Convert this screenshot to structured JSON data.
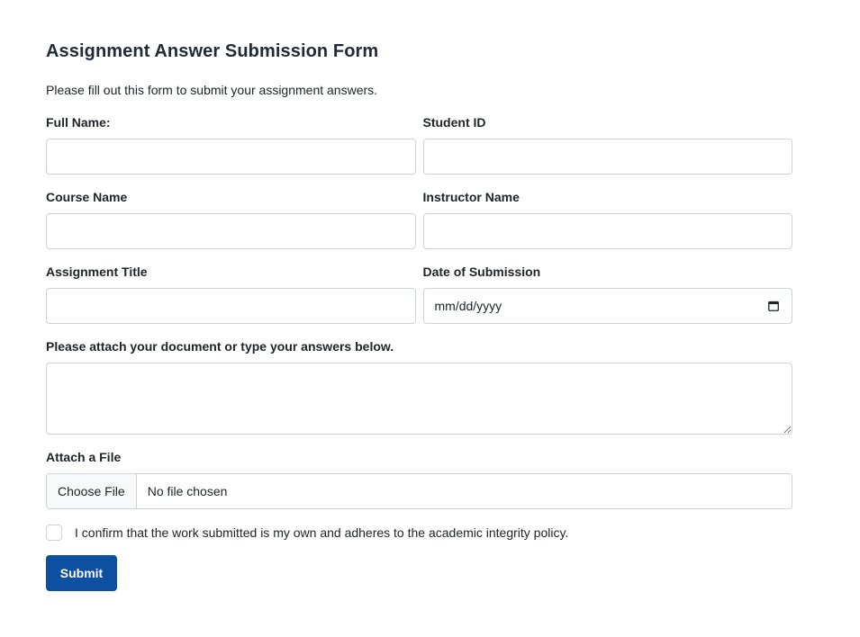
{
  "form": {
    "title": "Assignment Answer Submission Form",
    "description": "Please fill out this form to submit your assignment answers.",
    "fields": {
      "full_name": {
        "label": "Full Name:",
        "value": "",
        "placeholder": ""
      },
      "student_id": {
        "label": "Student ID",
        "value": "",
        "placeholder": ""
      },
      "course_name": {
        "label": "Course Name",
        "value": "",
        "placeholder": ""
      },
      "instructor_name": {
        "label": "Instructor Name",
        "value": "",
        "placeholder": ""
      },
      "assignment_title": {
        "label": "Assignment Title",
        "value": "",
        "placeholder": ""
      },
      "date_of_submission": {
        "label": "Date of Submission",
        "display": "mm/dd/yyyy",
        "icon": "calendar-icon"
      },
      "answers": {
        "label": "Please attach your document or type your answers below.",
        "value": ""
      },
      "attachment": {
        "label": "Attach a File",
        "button_label": "Choose File",
        "status": "No file chosen"
      }
    },
    "confirmation": {
      "label": "I confirm that the work submitted is my own and adheres to the academic integrity policy.",
      "checked": false
    },
    "submit_label": "Submit"
  },
  "colors": {
    "primary_button": "#0d4fa0",
    "border": "#ced4da",
    "text": "#212529"
  }
}
